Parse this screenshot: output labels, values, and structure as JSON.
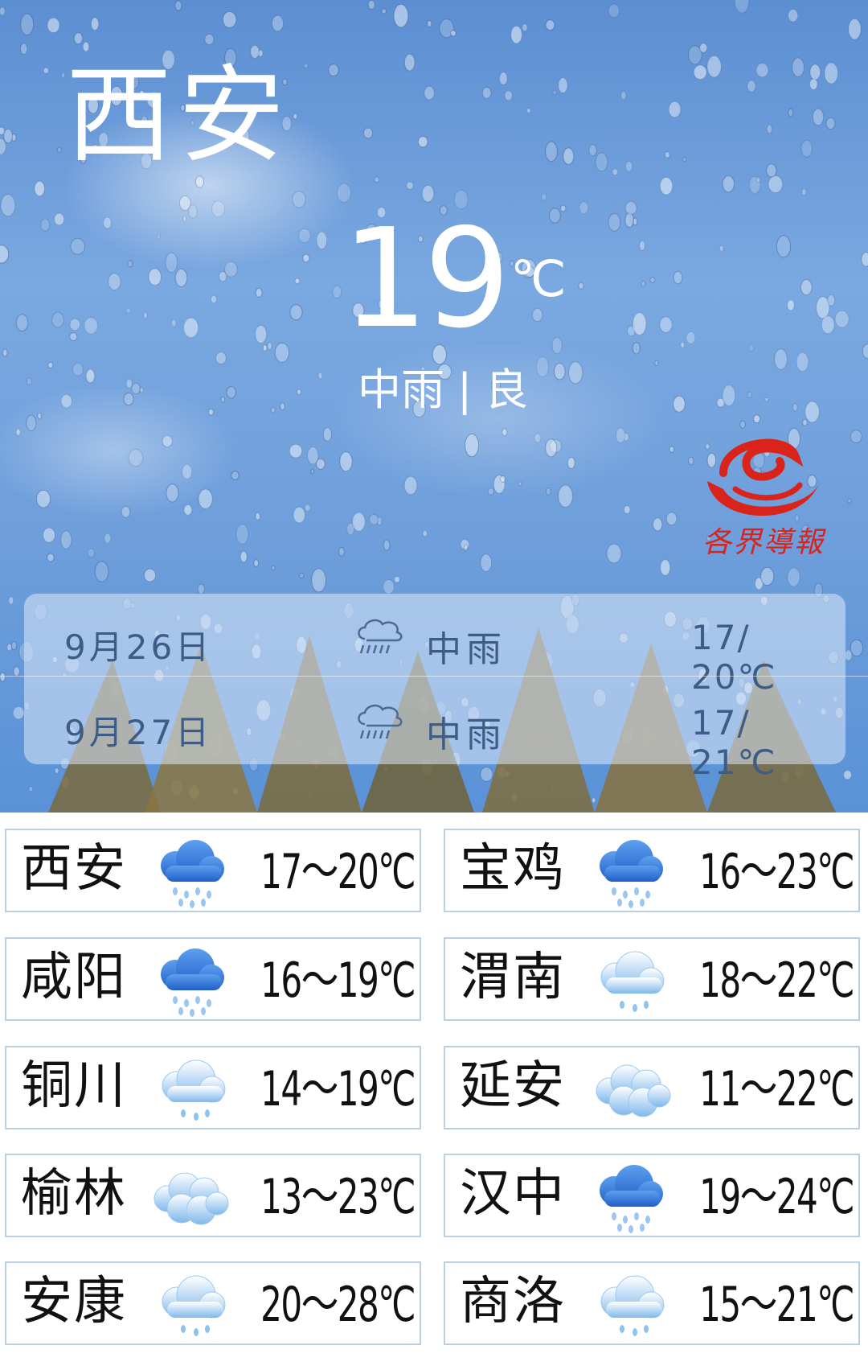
{
  "header": {
    "city": "西安",
    "temperature": "19",
    "unit": "℃",
    "condition": "中雨",
    "separator": "|",
    "air_quality": "良"
  },
  "brand": {
    "name": "各界導報",
    "logo_icon": "red-swirl-logo-icon",
    "color": "#d9231b"
  },
  "forecast": [
    {
      "date": "9月26日",
      "icon": "rain-cloud-outline-icon",
      "condition": "中雨",
      "range": "17/ 20℃"
    },
    {
      "date": "9月27日",
      "icon": "rain-cloud-outline-icon",
      "condition": "中雨",
      "range": "17/ 21℃"
    }
  ],
  "cities": [
    {
      "name": "西安",
      "icon": "heavy-rain-icon",
      "temp": "17～20℃"
    },
    {
      "name": "宝鸡",
      "icon": "heavy-rain-icon",
      "temp": "16～23℃"
    },
    {
      "name": "咸阳",
      "icon": "heavy-rain-icon",
      "temp": "16～19℃"
    },
    {
      "name": "渭南",
      "icon": "light-rain-icon",
      "temp": "18～22℃"
    },
    {
      "name": "铜川",
      "icon": "light-rain-icon",
      "temp": "14～19℃"
    },
    {
      "name": "延安",
      "icon": "cloudy-icon",
      "temp": "11～22℃"
    },
    {
      "name": "榆林",
      "icon": "cloudy-icon",
      "temp": "13～23℃"
    },
    {
      "name": "汉中",
      "icon": "heavy-rain-icon",
      "temp": "19～24℃"
    },
    {
      "name": "安康",
      "icon": "light-rain-icon",
      "temp": "20～28℃"
    },
    {
      "name": "商洛",
      "icon": "light-rain-icon",
      "temp": "15～21℃"
    }
  ],
  "colors": {
    "sky": "#6f9fdb",
    "card_border": "#b8cfe6",
    "forecast_text": "#3d5c86",
    "heavy_rain": "#2f72d6",
    "light_rain": "#8cc3ef"
  }
}
